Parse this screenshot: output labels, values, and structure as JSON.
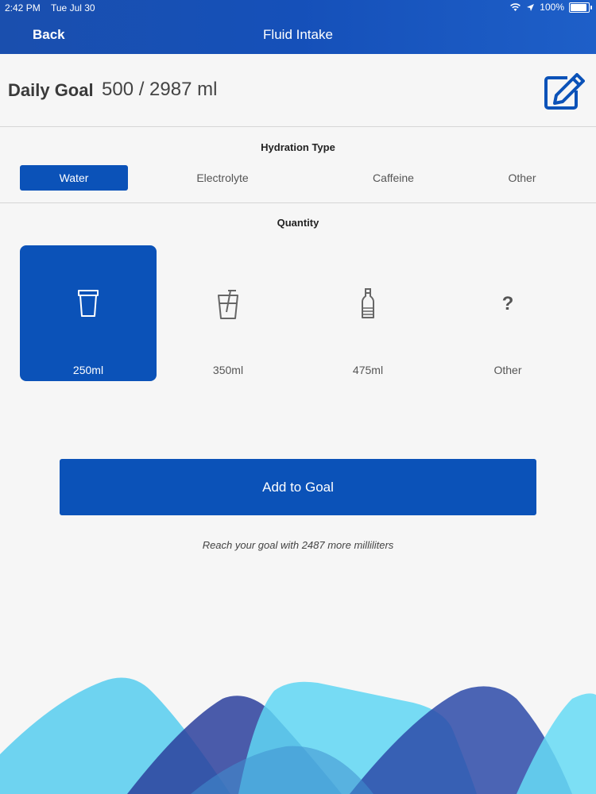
{
  "status_bar": {
    "time": "2:42 PM",
    "date": "Tue Jul 30",
    "battery": "100%",
    "battery_level": 1.0,
    "icons": [
      "wifi-icon",
      "location-arrow-icon",
      "battery-icon"
    ]
  },
  "nav": {
    "back_label": "Back",
    "title": "Fluid Intake"
  },
  "goal": {
    "label": "Daily Goal",
    "value": "500 / 2987 ml",
    "edit_icon": "edit-icon"
  },
  "hydration": {
    "title": "Hydration Type",
    "types": [
      {
        "label": "Water",
        "selected": true
      },
      {
        "label": "Electrolyte",
        "selected": false
      },
      {
        "label": "Caffeine",
        "selected": false
      },
      {
        "label": "Other",
        "selected": false
      }
    ]
  },
  "quantity": {
    "title": "Quantity",
    "options": [
      {
        "label": "250ml",
        "icon": "cup-icon",
        "selected": true
      },
      {
        "label": "350ml",
        "icon": "cup-with-straw-icon",
        "selected": false
      },
      {
        "label": "475ml",
        "icon": "bottle-icon",
        "selected": false
      },
      {
        "label": "Other",
        "icon": "question-mark-icon",
        "glyph": "?",
        "selected": false
      }
    ]
  },
  "action": {
    "add_label": "Add to Goal",
    "hint": "Reach your goal with 2487 more milliliters"
  },
  "colors": {
    "accent": "#0b52b8",
    "header": "#1550b9",
    "background": "#f6f6f6",
    "wave_light": "#5fd6f3",
    "wave_dark": "#2b3f9c"
  }
}
